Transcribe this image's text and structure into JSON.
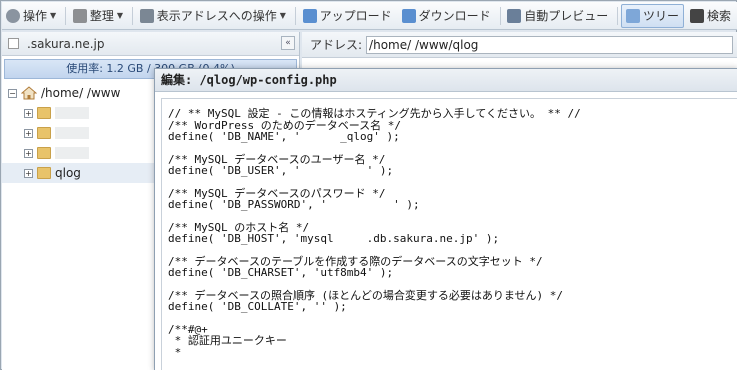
{
  "toolbar": {
    "items": [
      {
        "label": "操作",
        "icon": "gear-icon"
      },
      {
        "label": "整理",
        "icon": "wrench-icon"
      },
      {
        "label": "表示アドレスへの操作",
        "icon": "address-icon"
      },
      {
        "label": "アップロード",
        "icon": "upload-icon"
      },
      {
        "label": "ダウンロード",
        "icon": "download-icon"
      },
      {
        "label": "自動プレビュー",
        "icon": "monitor-icon"
      },
      {
        "label": "ツリー",
        "icon": "tree-icon"
      },
      {
        "label": "検索",
        "icon": "binoculars-icon"
      }
    ]
  },
  "left": {
    "domain": ".sakura.ne.jp",
    "usage": "使用率: 1.2 GB / 300 GB (0.4%)",
    "tree": {
      "root_label": "/home/      /www",
      "children": [
        "",
        "",
        "",
        "qlog"
      ]
    }
  },
  "right": {
    "address_label": "アドレス:",
    "address_value": "/home/      /www/qlog"
  },
  "editor": {
    "title": "編集: /qlog/wp-config.php",
    "lines": [
      "// ** MySQL 設定 - この情報はホスティング先から入手してください。 ** //",
      "/** WordPress のためのデータベース名 */",
      "define( 'DB_NAME', '      _qlog' );",
      "",
      "/** MySQL データベースのユーザー名 */",
      "define( 'DB_USER', '          ' );",
      "",
      "/** MySQL データベースのパスワード */",
      "define( 'DB_PASSWORD', '          ' );",
      "",
      "/** MySQL のホスト名 */",
      "define( 'DB_HOST', 'mysql     .db.sakura.ne.jp' );",
      "",
      "/** データベースのテーブルを作成する際のデータベースの文字セット */",
      "define( 'DB_CHARSET', 'utf8mb4' );",
      "",
      "/** データベースの照合順序 (ほとんどの場合変更する必要はありません) */",
      "define( 'DB_COLLATE', '' );",
      "",
      "/**#@+",
      " * 認証用ユニークキー",
      " *"
    ]
  }
}
